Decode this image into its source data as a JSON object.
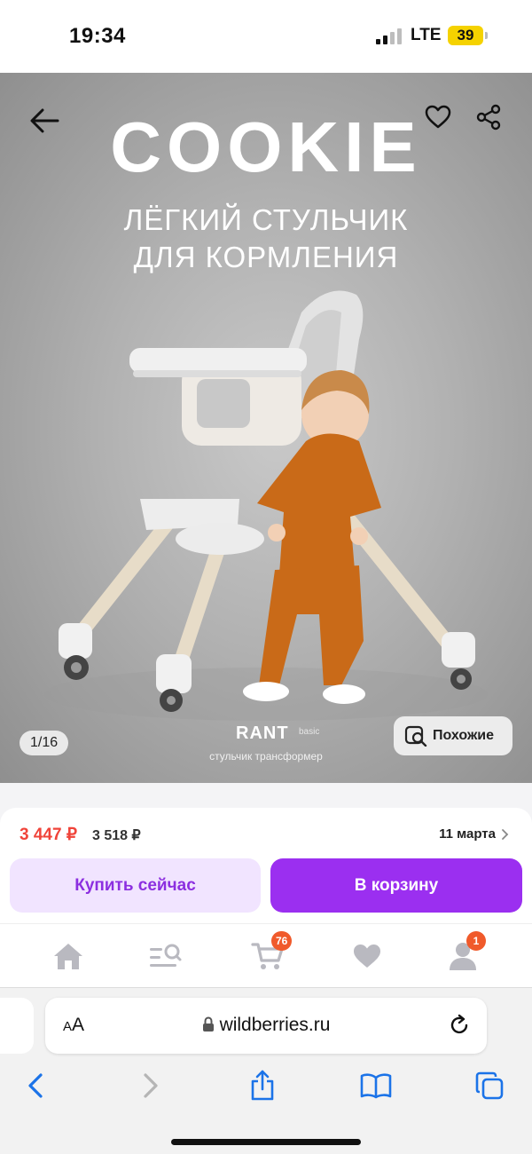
{
  "status_bar": {
    "time": "19:34",
    "network": "LTE",
    "battery": "39"
  },
  "photo": {
    "brand": "COOKIE",
    "subtitle_line1": "ЛЁГКИЙ СТУЛЬЧИК",
    "subtitle_line2": "ДЛЯ КОРМЛЕНИЯ",
    "logo": "RANT",
    "logo_sub": "basic",
    "tagline": "стульчик трансформер",
    "counter": "1/16",
    "similar_label": "Похожие",
    "icons": {
      "back": "arrow-left-icon",
      "favorite": "heart-outline-icon",
      "share": "share-icon",
      "similar": "image-search-icon"
    }
  },
  "product": {
    "price": "3 447 ₽",
    "old_price": "3 518 ₽",
    "delivery_date": "11 марта",
    "buy_now_label": "Купить сейчас",
    "add_to_cart_label": "В корзину"
  },
  "tabbar": {
    "cart_badge": "76",
    "profile_badge": "1",
    "badge_color": "#f05a2b",
    "items": [
      "home-icon",
      "catalog-search-icon",
      "cart-icon",
      "heart-icon",
      "profile-icon"
    ]
  },
  "browser": {
    "aa_small": "A",
    "aa_large": "A",
    "url": "wildberries.ru",
    "toolbar": [
      "back-chevron-icon",
      "forward-chevron-icon",
      "share-icon",
      "bookmarks-icon",
      "tabs-icon"
    ]
  },
  "colors": {
    "accent": "#9b2ff0",
    "accent_light": "#f1e4ff",
    "price_red": "#f0443a",
    "link_blue": "#1b73e8"
  }
}
